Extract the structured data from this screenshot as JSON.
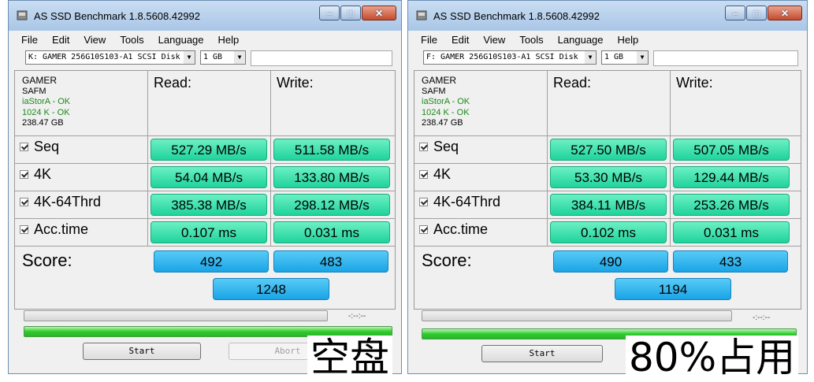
{
  "windows": [
    {
      "title": "AS SSD Benchmark 1.8.5608.42992",
      "menu": [
        "File",
        "Edit",
        "View",
        "Tools",
        "Language",
        "Help"
      ],
      "drive_select": "K: GAMER 256G10S103-A1 SCSI Disk",
      "size_select": "1 GB",
      "info": {
        "name": "GAMER",
        "firmware": "SAFM",
        "driver": "iaStorA - OK",
        "alignment": "1024 K - OK",
        "capacity": "238.47 GB"
      },
      "read_header": "Read:",
      "write_header": "Write:",
      "rows": [
        {
          "label": "Seq",
          "read": "527.29 MB/s",
          "write": "511.58 MB/s"
        },
        {
          "label": "4K",
          "read": "54.04 MB/s",
          "write": "133.80 MB/s"
        },
        {
          "label": "4K-64Thrd",
          "read": "385.38 MB/s",
          "write": "298.12 MB/s"
        },
        {
          "label": "Acc.time",
          "read": "0.107 ms",
          "write": "0.031 ms"
        }
      ],
      "score_label": "Score:",
      "score_read": "492",
      "score_write": "483",
      "score_total": "1248",
      "time_display": "-:--:--",
      "progress": 1.0,
      "start_label": "Start",
      "abort_label": "Abort",
      "caption": "空盘"
    },
    {
      "title": "AS SSD Benchmark 1.8.5608.42992",
      "menu": [
        "File",
        "Edit",
        "View",
        "Tools",
        "Language",
        "Help"
      ],
      "drive_select": "F: GAMER 256G10S103-A1 SCSI Disk",
      "size_select": "1 GB",
      "info": {
        "name": "GAMER",
        "firmware": "SAFM",
        "driver": "iaStorA - OK",
        "alignment": "1024 K - OK",
        "capacity": "238.47 GB"
      },
      "read_header": "Read:",
      "write_header": "Write:",
      "rows": [
        {
          "label": "Seq",
          "read": "527.50 MB/s",
          "write": "507.05 MB/s"
        },
        {
          "label": "4K",
          "read": "53.30 MB/s",
          "write": "129.44 MB/s"
        },
        {
          "label": "4K-64Thrd",
          "read": "384.11 MB/s",
          "write": "253.26 MB/s"
        },
        {
          "label": "Acc.time",
          "read": "0.102 ms",
          "write": "0.031 ms"
        }
      ],
      "score_label": "Score:",
      "score_read": "490",
      "score_write": "433",
      "score_total": "1194",
      "time_display": "-:--:--",
      "progress": 1.0,
      "start_label": "Start",
      "caption": "80%占用"
    }
  ],
  "colors": {
    "result_green": "#2ad8a0",
    "score_blue": "#2ab0ee",
    "progress_green": "#2fcb2f",
    "ok_text": "#1a8a1a"
  }
}
